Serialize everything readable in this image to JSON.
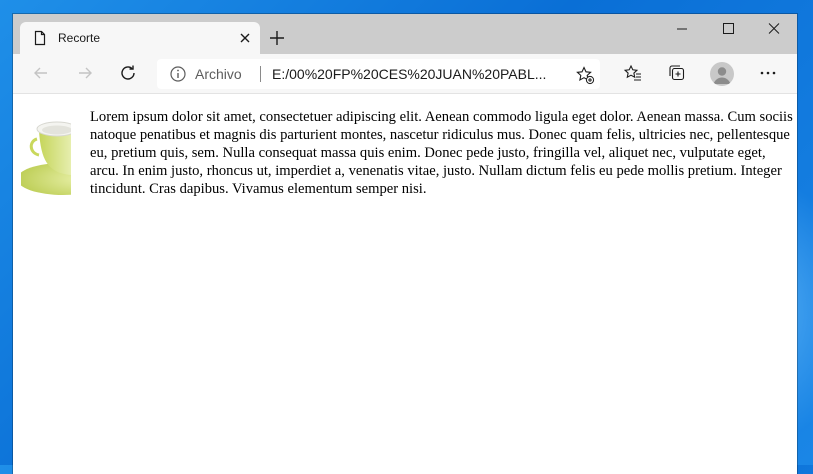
{
  "tab": {
    "title": "Recorte"
  },
  "address_bar": {
    "site_label": "Archivo",
    "url": "E:/00%20FP%20CES%20JUAN%20PABL..."
  },
  "content": {
    "paragraph": "Lorem ipsum dolor sit amet, consectetuer adipiscing elit. Aenean commodo ligula eget dolor. Aenean massa. Cum sociis natoque penatibus et magnis dis parturient montes, nascetur ridiculus mus. Donec quam felis, ultricies nec, pellentesque eu, pretium quis, sem. Nulla consequat massa quis enim. Donec pede justo, fringilla vel, aliquet nec, vulputate eget, arcu. In enim justo, rhoncus ut, imperdiet a, venenatis vitae, justo. Nullam dictum felis eu pede mollis pretium. Integer tincidunt. Cras dapibus. Vivamus elementum semper nisi."
  },
  "icons": {
    "tab": [
      "page-icon",
      "close-icon",
      "plus-icon"
    ],
    "window": [
      "minimize-icon",
      "maximize-icon",
      "close-icon"
    ],
    "toolbar": [
      "back-arrow-icon",
      "forward-arrow-icon",
      "refresh-icon",
      "info-icon",
      "add-favorite-icon",
      "favorites-icon",
      "collections-icon",
      "profile-icon",
      "more-icon"
    ]
  },
  "colors": {
    "tabstrip": "#cccccc",
    "toolbar": "#f7f7f7",
    "desktop": "#0a6fd6",
    "cup": "#cddc6b"
  }
}
